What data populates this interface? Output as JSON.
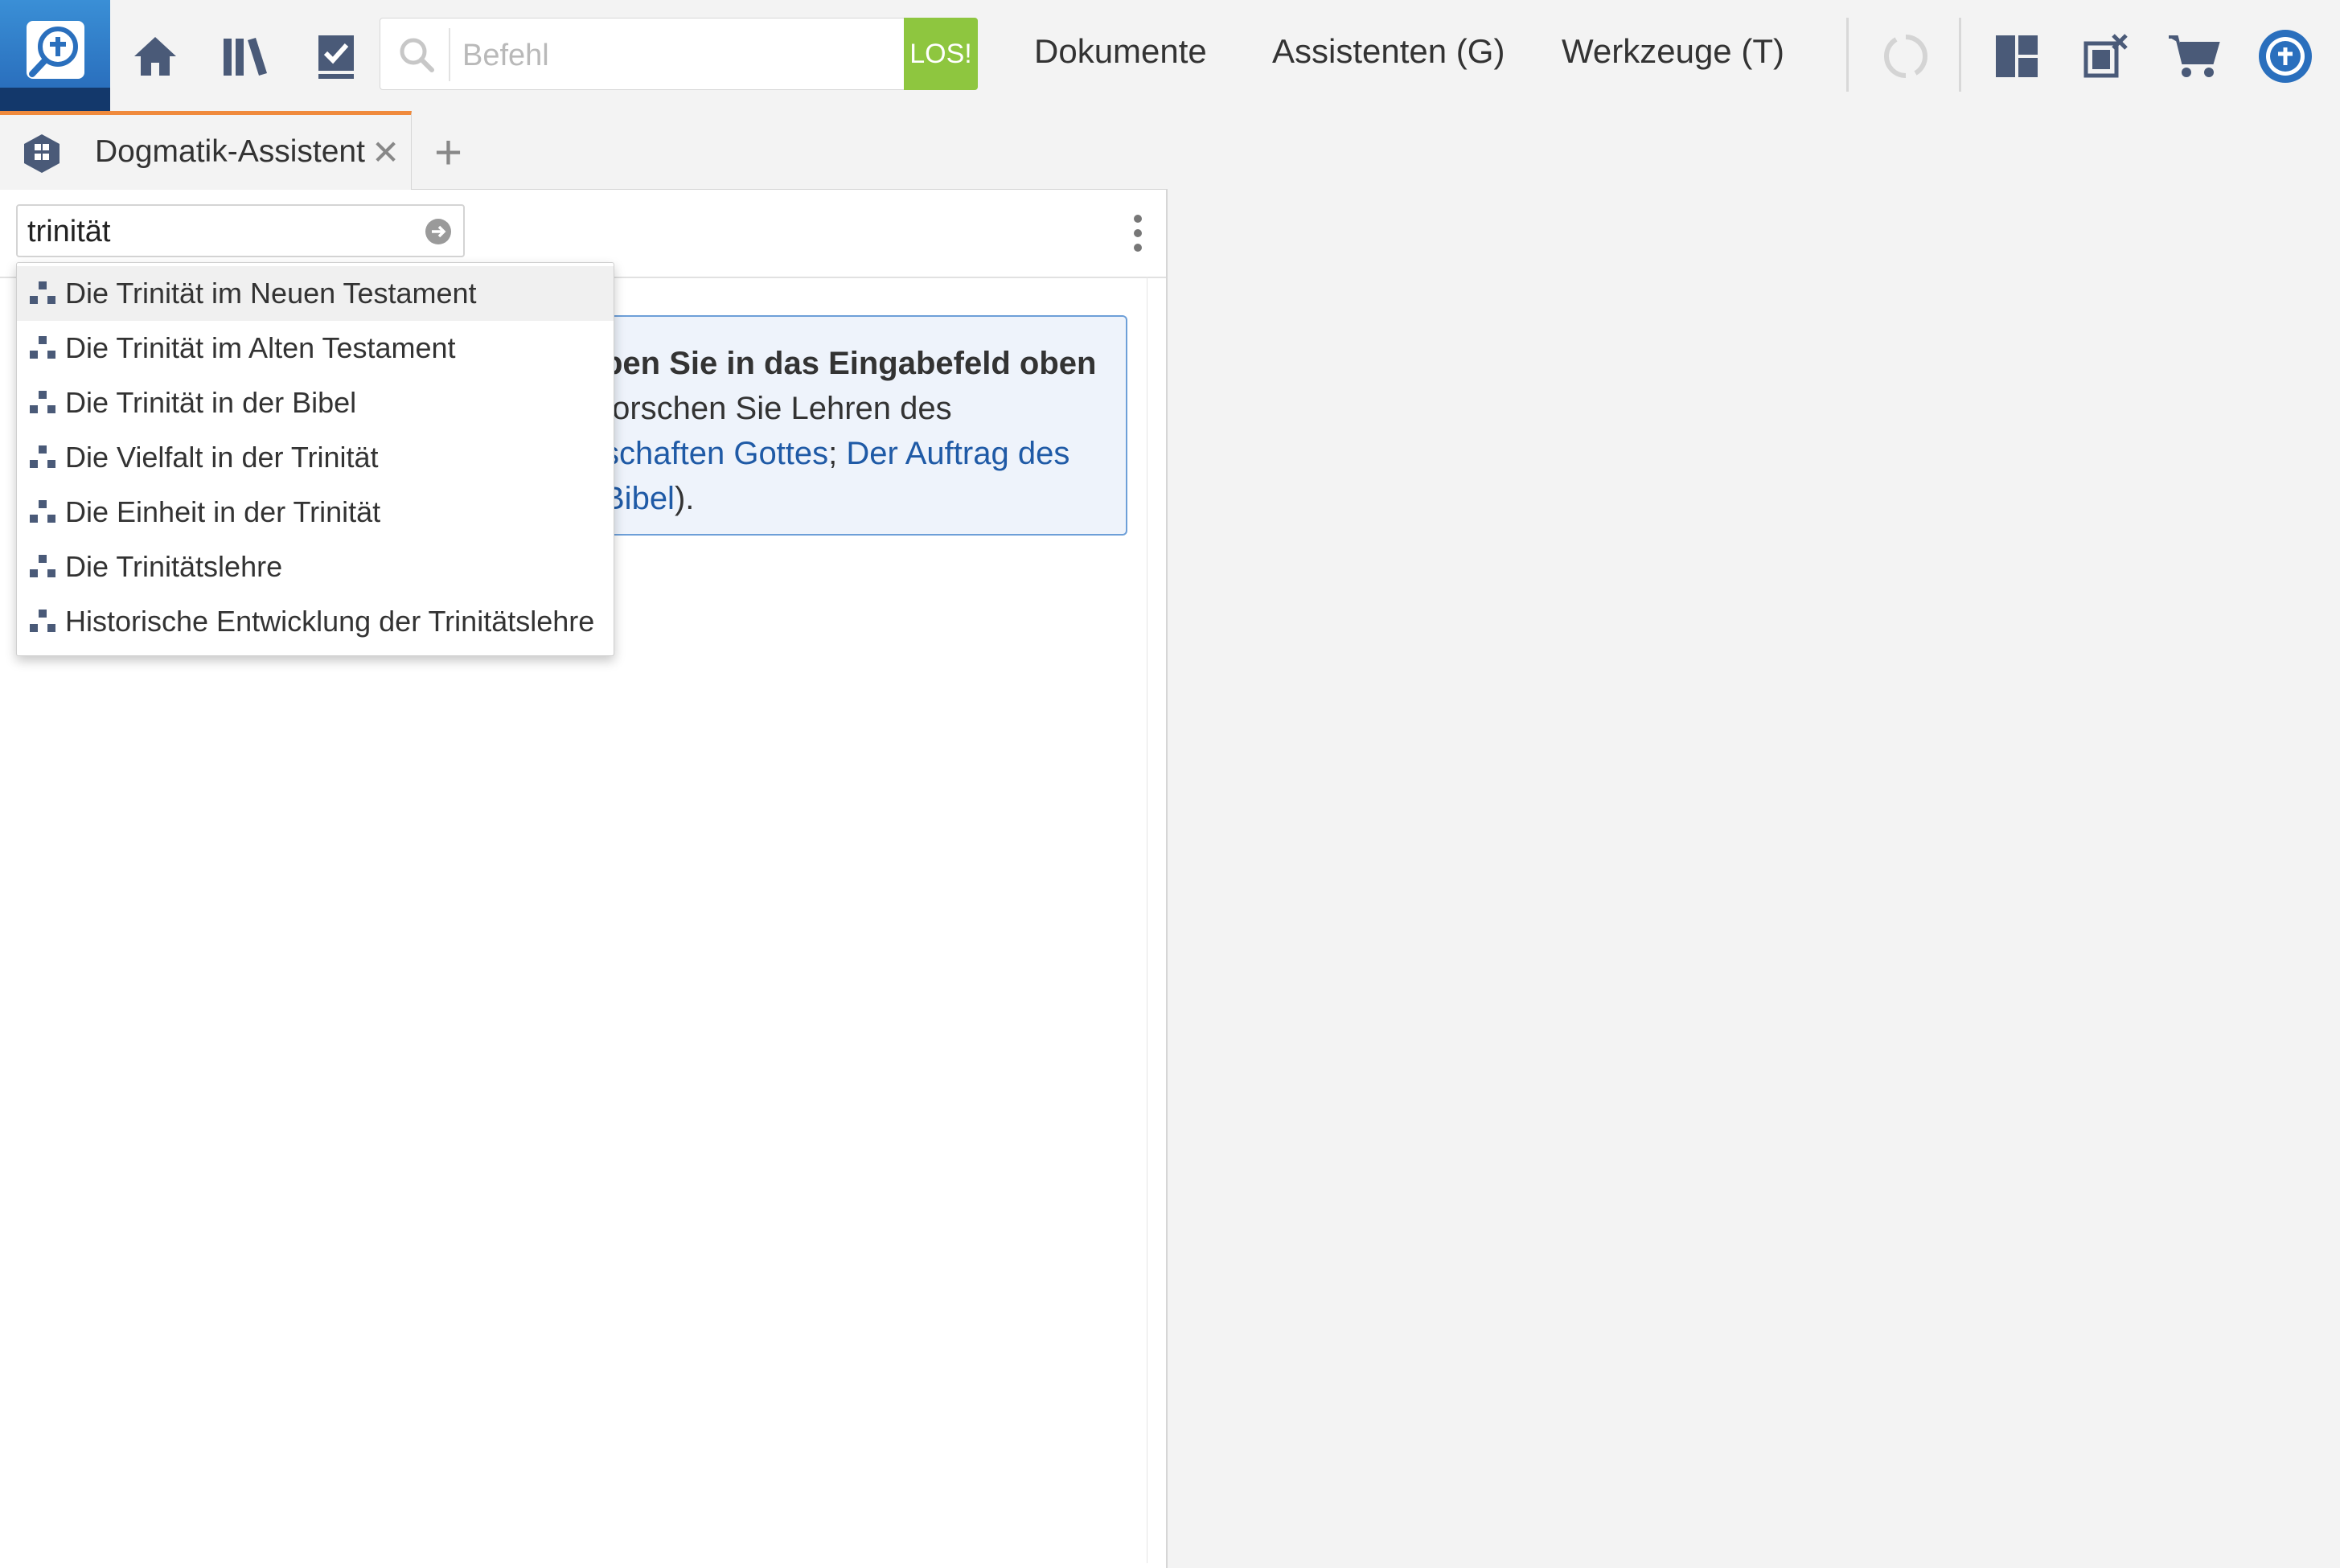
{
  "toolbar": {
    "command_placeholder": "Befehl",
    "go_label": "LOS!",
    "menu": [
      "Dokumente",
      "Assistenten (G)",
      "Werkzeuge (T)"
    ]
  },
  "tab": {
    "label": "Dogmatik-Assistent",
    "close": "✕",
    "add": "+"
  },
  "panel": {
    "search_value": "trinität",
    "info": {
      "bold": "ben Sie in das Eingabefeld oben",
      "line2": "forschen Sie Lehren des",
      "link1": "schaften Gottes",
      "sep": "; ",
      "link2": "Der Auftrag des",
      "link3": "Bibel",
      "end": ")."
    }
  },
  "suggestions": [
    "Die Trinität im Neuen Testament",
    "Die Trinität im Alten Testament",
    "Die Trinität in der Bibel",
    "Die Vielfalt in der Trinität",
    "Die Einheit in der Trinität",
    "Die Trinitätslehre",
    "Historische Entwicklung der Trinitätslehre"
  ],
  "colors": {
    "accent_orange": "#f08a3c",
    "go_green": "#8ec63f",
    "logo_blue": "#2a6fbd",
    "link_blue": "#1f5aa6",
    "icon_slate": "#4a5a78"
  },
  "icons": [
    "logos-search-icon",
    "home-icon",
    "library-icon",
    "checklist-icon",
    "search-icon",
    "sync-icon",
    "layout-icon",
    "close-panels-icon",
    "cart-icon",
    "account-icon",
    "guide-icon",
    "arrow-right-circle-icon",
    "more-vertical-icon",
    "topic-icon"
  ]
}
